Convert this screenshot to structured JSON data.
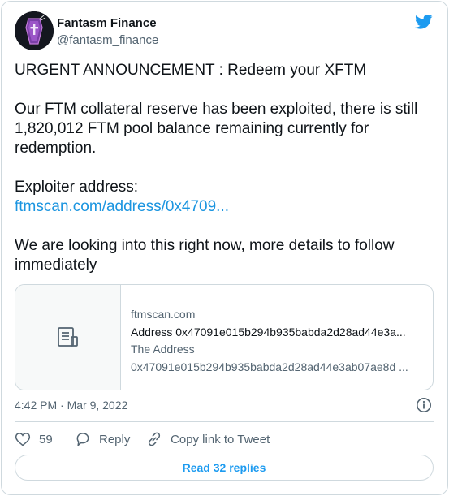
{
  "author": {
    "name": "Fantasm Finance",
    "handle": "@fantasm_finance"
  },
  "tweet": {
    "line1": "URGENT ANNOUNCEMENT : Redeem your XFTM",
    "line2": "Our FTM collateral reserve has been exploited, there is still 1,820,012 FTM pool balance remaining currently for redemption.",
    "line3": "Exploiter address:",
    "link": "ftmscan.com/address/0x4709...",
    "line4": "We are looking into this right now, more details to follow immediately"
  },
  "preview": {
    "domain": "ftmscan.com",
    "title": "Address 0x47091e015b294b935babda2d28ad44e3a...",
    "desc_line1": "The Address",
    "desc_line2": "0x47091e015b294b935babda2d28ad44e3ab07ae8d ..."
  },
  "meta": {
    "timestamp": "4:42 PM · Mar 9, 2022"
  },
  "actions": {
    "like_count": "59",
    "reply_label": "Reply",
    "copy_label": "Copy link to Tweet",
    "read_replies": "Read 32 replies"
  },
  "colors": {
    "link": "#1b95e0",
    "accent": "#1d9bf0",
    "secondary_text": "#536471",
    "border": "#cfd9de"
  }
}
